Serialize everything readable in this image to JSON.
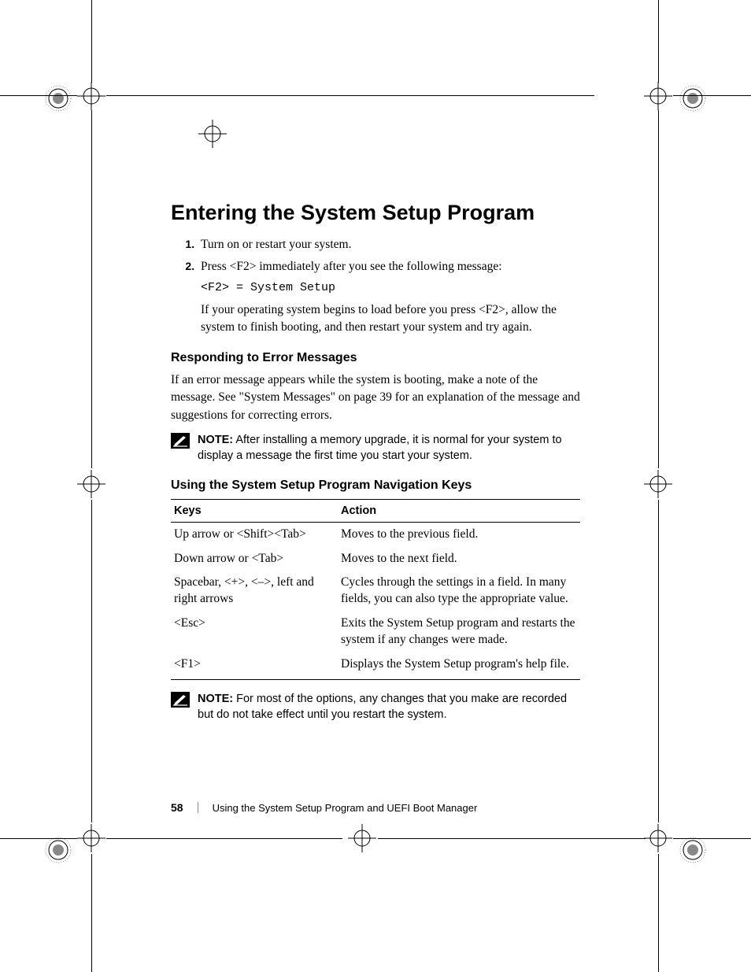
{
  "heading": "Entering the System Setup Program",
  "steps": {
    "s1": "Turn on or restart your system.",
    "s2_a": "Press <F2> immediately after you see the following message:",
    "s2_code": "<F2> = System Setup",
    "s2_b": "If your operating system begins to load before you press <F2>, allow the system to finish booting, and then restart your system and try again."
  },
  "sec1_heading": "Responding to Error Messages",
  "sec1_body": "If an error message appears while the system is booting, make a note of the message. See \"System Messages\" on page 39 for an explanation of the message and suggestions for correcting errors.",
  "note1_label": "NOTE:",
  "note1_text": " After installing a memory upgrade, it is normal for your system to display a message the first time you start your system.",
  "sec2_heading": "Using the System Setup Program Navigation Keys",
  "table": {
    "h1": "Keys",
    "h2": "Action",
    "r1k": "Up arrow or <Shift><Tab>",
    "r1a": "Moves to the previous field.",
    "r2k": "Down arrow or <Tab>",
    "r2a": "Moves to the next field.",
    "r3k": "Spacebar, <+>, <–>, left and right arrows",
    "r3a": "Cycles through the settings in a field. In many fields, you can also type the appropriate value.",
    "r4k": "<Esc>",
    "r4a": "Exits the System Setup program and restarts the system if any changes were made.",
    "r5k": "<F1>",
    "r5a": "Displays the System Setup program's help file."
  },
  "note2_label": "NOTE:",
  "note2_text": " For most of the options, any changes that you make are recorded but do not take effect until you restart the system.",
  "footer": {
    "page": "58",
    "title": "Using the System Setup Program and UEFI Boot Manager"
  }
}
